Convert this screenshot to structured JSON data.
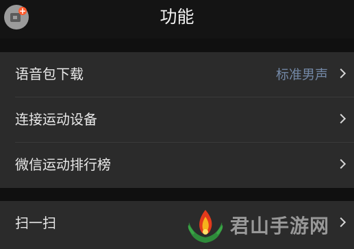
{
  "header": {
    "title": "功能",
    "app_icon": "add-card-icon"
  },
  "colors": {
    "header_bg": "#141414",
    "row_bg": "#2b2b2b",
    "value_text": "#7388a6",
    "badge": "#ff5a2c"
  },
  "groups": [
    {
      "rows": [
        {
          "label": "语音包下载",
          "value": "标准男声",
          "icon": "chevron-right-icon"
        },
        {
          "label": "连接运动设备",
          "icon": "chevron-right-icon"
        },
        {
          "label": "微信运动排行榜",
          "icon": "chevron-right-icon"
        }
      ]
    },
    {
      "rows": [
        {
          "label": "扫一扫",
          "icon": "chevron-right-icon"
        }
      ]
    }
  ],
  "watermark": {
    "text": "君山手游网",
    "icon": "laurel-flame-logo"
  }
}
